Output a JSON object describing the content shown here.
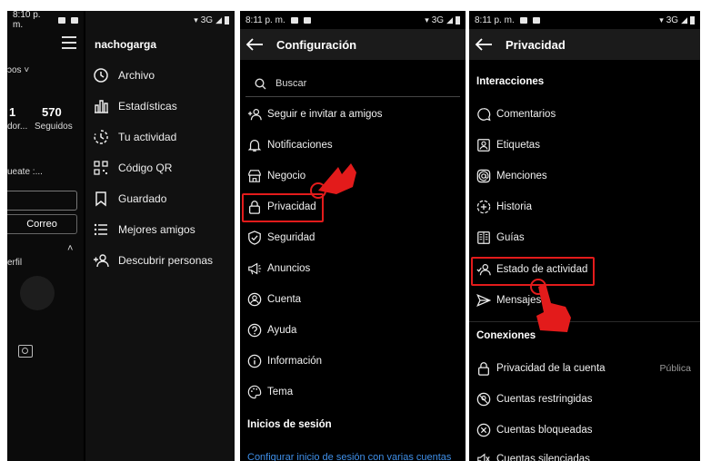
{
  "panel1": {
    "status": {
      "time": "8:10 p. m.",
      "network": "3G"
    },
    "profile": {
      "dropdown": "ɔos",
      "posts": "1",
      "posts_label": "dor...",
      "following": "570",
      "following_label": "Seguidos",
      "bio": "ueate :...",
      "mail_button": "Correo",
      "perfil": "erfil"
    },
    "drawer": {
      "username": "nachogarga",
      "items": [
        {
          "label": "Archivo",
          "icon": "history-icon"
        },
        {
          "label": "Estadísticas",
          "icon": "bar-chart-icon"
        },
        {
          "label": "Tu actividad",
          "icon": "activity-clock-icon"
        },
        {
          "label": "Código QR",
          "icon": "qr-code-icon"
        },
        {
          "label": "Guardado",
          "icon": "bookmark-icon"
        },
        {
          "label": "Mejores amigos",
          "icon": "list-icon"
        },
        {
          "label": "Descubrir personas",
          "icon": "add-person-icon"
        }
      ]
    }
  },
  "panel2": {
    "status": {
      "time": "8:11 p. m.",
      "network": "3G"
    },
    "title": "Configuración",
    "search_placeholder": "Buscar",
    "items": [
      {
        "label": "Seguir e invitar a amigos",
        "icon": "add-person-icon"
      },
      {
        "label": "Notificaciones",
        "icon": "bell-icon"
      },
      {
        "label": "Negocio",
        "icon": "store-icon"
      },
      {
        "label": "Privacidad",
        "icon": "lock-icon"
      },
      {
        "label": "Seguridad",
        "icon": "shield-icon"
      },
      {
        "label": "Anuncios",
        "icon": "megaphone-icon"
      },
      {
        "label": "Cuenta",
        "icon": "account-circle-icon"
      },
      {
        "label": "Ayuda",
        "icon": "help-icon"
      },
      {
        "label": "Información",
        "icon": "info-icon"
      },
      {
        "label": "Tema",
        "icon": "palette-icon"
      }
    ],
    "section": "Inicios de sesión",
    "multi_login_link": "Configurar inicio de sesión con varias cuentas"
  },
  "panel3": {
    "status": {
      "time": "8:11 p. m.",
      "network": "3G"
    },
    "title": "Privacidad",
    "section_interactions": "Interacciones",
    "interactions": [
      {
        "label": "Comentarios",
        "icon": "comment-icon"
      },
      {
        "label": "Etiquetas",
        "icon": "tag-person-icon"
      },
      {
        "label": "Menciones",
        "icon": "at-sign-icon"
      },
      {
        "label": "Historia",
        "icon": "story-add-icon"
      },
      {
        "label": "Guías",
        "icon": "guide-book-icon"
      },
      {
        "label": "Estado de actividad",
        "icon": "activity-status-icon"
      },
      {
        "label": "Mensajes",
        "icon": "send-icon"
      }
    ],
    "section_connections": "Conexiones",
    "connections": [
      {
        "label": "Privacidad de la cuenta",
        "icon": "lock-icon",
        "value": "Pública"
      },
      {
        "label": "Cuentas restringidas",
        "icon": "restricted-icon"
      },
      {
        "label": "Cuentas bloqueadas",
        "icon": "blocked-icon"
      },
      {
        "label": "Cuentas silenciadas",
        "icon": "muted-icon"
      }
    ]
  },
  "highlight_color": "#e31b1b",
  "link_color": "#3f8fe8"
}
